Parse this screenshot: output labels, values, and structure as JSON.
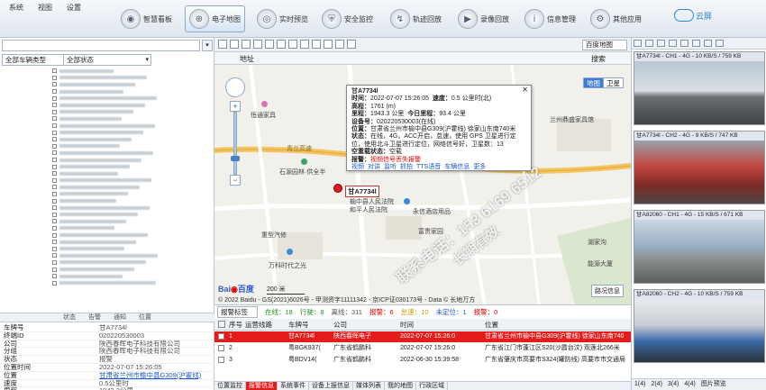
{
  "menu": [
    "系统",
    "视图",
    "设置"
  ],
  "nav": [
    {
      "label": "智慧看板",
      "icon": "dashboard-icon",
      "active": false
    },
    {
      "label": "电子地图",
      "icon": "map-icon",
      "active": true
    },
    {
      "label": "实时预览",
      "icon": "camera-icon",
      "active": false
    },
    {
      "label": "安全监控",
      "icon": "shield-icon",
      "active": false
    },
    {
      "label": "轨迹回放",
      "icon": "track-icon",
      "active": false
    },
    {
      "label": "录像回放",
      "icon": "playback-icon",
      "active": false
    },
    {
      "label": "信息管理",
      "icon": "info-icon",
      "active": false
    },
    {
      "label": "其他应用",
      "icon": "apps-icon",
      "active": false
    }
  ],
  "cloud_label": "云屏",
  "left": {
    "search_placeholder": "",
    "filter_type": "全部车辆类型",
    "filter_status": "全部状态",
    "tree_rows": 32,
    "divider_tabs": [
      "状态",
      "告警",
      "通知",
      "位置"
    ],
    "props": [
      {
        "key": "车牌号",
        "value": "甘A7734l",
        "link": false
      },
      {
        "key": "终端ID",
        "value": "020220530003",
        "link": false
      },
      {
        "key": "公司",
        "value": "陕西春晖电子科技有限公司",
        "link": false
      },
      {
        "key": "分组",
        "value": "陕西春晖电子科技有限公司",
        "link": false
      },
      {
        "key": "状态",
        "value": "报警",
        "link": false
      },
      {
        "key": "位置时间",
        "value": "2022-07-07 15:26:05",
        "link": false
      },
      {
        "key": "位置",
        "value": "甘肃省兰州市榆中县G309(沪霍线)",
        "link": true
      },
      {
        "key": "速度",
        "value": "0.5公里时",
        "link": false
      },
      {
        "key": "里程",
        "value": "1943.3公里",
        "link": false
      },
      {
        "key": "使用",
        "value": "正常",
        "link": false
      }
    ]
  },
  "map": {
    "provider": "百度地图",
    "address_label": "地址",
    "search_label": "搜索",
    "map_type": [
      "地图",
      "卫星"
    ],
    "labels": [
      {
        "text": "恒通家具"
      },
      {
        "text": "青兰高速"
      },
      {
        "text": "石源园林·供全半"
      },
      {
        "text": "榆中县人民法院"
      },
      {
        "text": "和平人民法院"
      },
      {
        "text": "永信酒店用品"
      },
      {
        "text": "重型汽修"
      },
      {
        "text": "富贵家园"
      },
      {
        "text": "万科时代之光"
      },
      {
        "text": "兰州鼎盛家具馆"
      },
      {
        "text": "湖家沟"
      },
      {
        "text": "能源大厦"
      }
    ],
    "popup": {
      "plate": "甘A7734l",
      "time_label": "时间：",
      "time": "2022-07-07 15:26:05",
      "speed_label": "速度：",
      "speed": "0.5 公里时(北)",
      "alt_label": "高程：",
      "alt": "1761 (m)",
      "mileage_label": "里程：",
      "mileage": "1943.3 公里",
      "today_label": "今日里程：",
      "today": "93.4 公里",
      "device_label": "设备号：",
      "device": "020220530003(在线)",
      "loc_label": "位置：",
      "loc": "甘肃省兰州市榆中县G309(沪霍线) 徐家山东南740米",
      "status_label": "状态：",
      "status": "在线，4G，ACC开启，怠速，使用 GPS 卫星进行定位，使用北斗卫星进行定位，网络信号好，卫星数：13",
      "blind_label": "空重载状态：",
      "blind": "空载",
      "alarm_label": "报警：",
      "alarm": "视频信号丢失报警",
      "actions": [
        "视频",
        "对讲",
        "监听",
        "抓拍",
        "TTS语音",
        "车辆信息",
        "更多"
      ]
    },
    "marker_label": "甘A7734l",
    "scale": "200 米",
    "copyright": "© 2022 Baidu - GS(2021)6026号 - 甲测资字11111342 - 京ICP证030173号 - Data © 长地万方",
    "traffic_btn": "路况信息"
  },
  "alarm": {
    "tag_label": "报警标签",
    "counts": [
      {
        "label": "在线：",
        "value": "18",
        "color": "#1e8f1e"
      },
      {
        "label": "行驶：",
        "value": "8",
        "color": "#1e8f1e"
      },
      {
        "label": "离线：",
        "value": "311",
        "color": "#555"
      },
      {
        "label": "报警：",
        "value": "6",
        "color": "#d00"
      },
      {
        "label": "怠速：",
        "value": "10",
        "color": "#c7a000"
      },
      {
        "label": "未定位：",
        "value": "1",
        "color": "#1c58c9"
      },
      {
        "label": "报警：",
        "value": "0",
        "color": "#d00"
      }
    ],
    "columns": [
      "序号",
      "运营线路",
      "车牌号",
      "公司",
      "时间",
      "位置"
    ],
    "rows": [
      {
        "no": "1",
        "route": "",
        "plate": "甘A7734l",
        "company": "陕西春晖电子",
        "time": "2022-07-07 15:26:0",
        "loc": "甘肃省兰州市榆中县G309(沪霍线) 徐家山东南740"
      },
      {
        "no": "2",
        "route": "",
        "plate": "粤BGK937(",
        "company": "广东省鹤鹏科",
        "time": "2022-07-07 15:26:0",
        "loc": "广东省江门市蓬江区S20(沙霞台汶) 观莲北266米"
      },
      {
        "no": "3",
        "route": "",
        "plate": "粤BDV14(",
        "company": "广东省鹤鹏科",
        "time": "2022-06-30 15:39:58",
        "loc": "广东省肇庆市高要市S324(罐防线) 高要市市交通局"
      }
    ],
    "tabs": [
      "位置监控",
      "报警信息",
      "系统事件",
      "设备上报信息",
      "媒体列表",
      "我的地图",
      "行政区域"
    ],
    "active_tab": 1
  },
  "video": {
    "channels": [
      {
        "title": "甘A7734l - CH1 - 4G - 10 KB/S / 759 KB",
        "scene": "road"
      },
      {
        "title": "甘A7734l - CH2 - 4G - 9 KB/S / 747 KB",
        "scene": "truck"
      },
      {
        "title": "甘A82060 - CH1 - 4G - 15 KB/S / 671 KB",
        "scene": "city"
      },
      {
        "title": "甘A82060 - CH2 - 4G - 10 KB/S / 759 KB",
        "scene": "cabin"
      }
    ],
    "footer": [
      "1(4)",
      "2(4)",
      "3(4)",
      "4(4)",
      "图片预览"
    ]
  },
  "watermark": "联系电话：153 6169 6512",
  "watermark2": "长期有效"
}
